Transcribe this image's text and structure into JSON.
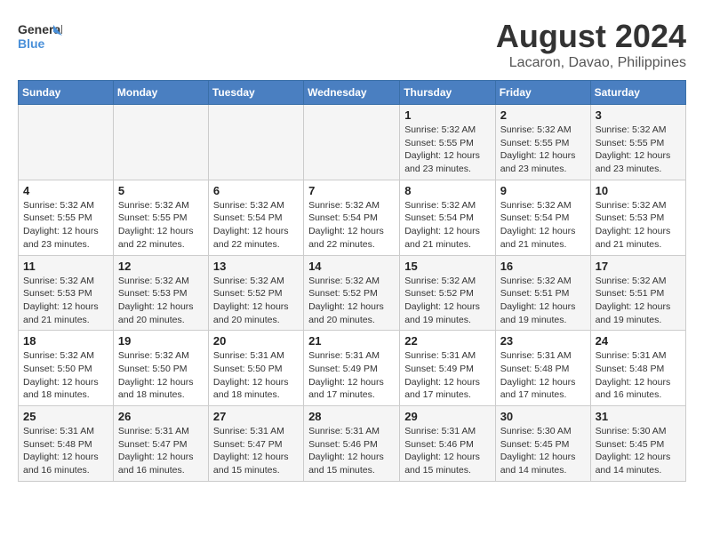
{
  "header": {
    "logo_line1": "General",
    "logo_line2": "Blue",
    "month_year": "August 2024",
    "location": "Lacaron, Davao, Philippines"
  },
  "days_of_week": [
    "Sunday",
    "Monday",
    "Tuesday",
    "Wednesday",
    "Thursday",
    "Friday",
    "Saturday"
  ],
  "weeks": [
    [
      {
        "day": "",
        "info": ""
      },
      {
        "day": "",
        "info": ""
      },
      {
        "day": "",
        "info": ""
      },
      {
        "day": "",
        "info": ""
      },
      {
        "day": "1",
        "info": "Sunrise: 5:32 AM\nSunset: 5:55 PM\nDaylight: 12 hours\nand 23 minutes."
      },
      {
        "day": "2",
        "info": "Sunrise: 5:32 AM\nSunset: 5:55 PM\nDaylight: 12 hours\nand 23 minutes."
      },
      {
        "day": "3",
        "info": "Sunrise: 5:32 AM\nSunset: 5:55 PM\nDaylight: 12 hours\nand 23 minutes."
      }
    ],
    [
      {
        "day": "4",
        "info": "Sunrise: 5:32 AM\nSunset: 5:55 PM\nDaylight: 12 hours\nand 23 minutes."
      },
      {
        "day": "5",
        "info": "Sunrise: 5:32 AM\nSunset: 5:55 PM\nDaylight: 12 hours\nand 22 minutes."
      },
      {
        "day": "6",
        "info": "Sunrise: 5:32 AM\nSunset: 5:54 PM\nDaylight: 12 hours\nand 22 minutes."
      },
      {
        "day": "7",
        "info": "Sunrise: 5:32 AM\nSunset: 5:54 PM\nDaylight: 12 hours\nand 22 minutes."
      },
      {
        "day": "8",
        "info": "Sunrise: 5:32 AM\nSunset: 5:54 PM\nDaylight: 12 hours\nand 21 minutes."
      },
      {
        "day": "9",
        "info": "Sunrise: 5:32 AM\nSunset: 5:54 PM\nDaylight: 12 hours\nand 21 minutes."
      },
      {
        "day": "10",
        "info": "Sunrise: 5:32 AM\nSunset: 5:53 PM\nDaylight: 12 hours\nand 21 minutes."
      }
    ],
    [
      {
        "day": "11",
        "info": "Sunrise: 5:32 AM\nSunset: 5:53 PM\nDaylight: 12 hours\nand 21 minutes."
      },
      {
        "day": "12",
        "info": "Sunrise: 5:32 AM\nSunset: 5:53 PM\nDaylight: 12 hours\nand 20 minutes."
      },
      {
        "day": "13",
        "info": "Sunrise: 5:32 AM\nSunset: 5:52 PM\nDaylight: 12 hours\nand 20 minutes."
      },
      {
        "day": "14",
        "info": "Sunrise: 5:32 AM\nSunset: 5:52 PM\nDaylight: 12 hours\nand 20 minutes."
      },
      {
        "day": "15",
        "info": "Sunrise: 5:32 AM\nSunset: 5:52 PM\nDaylight: 12 hours\nand 19 minutes."
      },
      {
        "day": "16",
        "info": "Sunrise: 5:32 AM\nSunset: 5:51 PM\nDaylight: 12 hours\nand 19 minutes."
      },
      {
        "day": "17",
        "info": "Sunrise: 5:32 AM\nSunset: 5:51 PM\nDaylight: 12 hours\nand 19 minutes."
      }
    ],
    [
      {
        "day": "18",
        "info": "Sunrise: 5:32 AM\nSunset: 5:50 PM\nDaylight: 12 hours\nand 18 minutes."
      },
      {
        "day": "19",
        "info": "Sunrise: 5:32 AM\nSunset: 5:50 PM\nDaylight: 12 hours\nand 18 minutes."
      },
      {
        "day": "20",
        "info": "Sunrise: 5:31 AM\nSunset: 5:50 PM\nDaylight: 12 hours\nand 18 minutes."
      },
      {
        "day": "21",
        "info": "Sunrise: 5:31 AM\nSunset: 5:49 PM\nDaylight: 12 hours\nand 17 minutes."
      },
      {
        "day": "22",
        "info": "Sunrise: 5:31 AM\nSunset: 5:49 PM\nDaylight: 12 hours\nand 17 minutes."
      },
      {
        "day": "23",
        "info": "Sunrise: 5:31 AM\nSunset: 5:48 PM\nDaylight: 12 hours\nand 17 minutes."
      },
      {
        "day": "24",
        "info": "Sunrise: 5:31 AM\nSunset: 5:48 PM\nDaylight: 12 hours\nand 16 minutes."
      }
    ],
    [
      {
        "day": "25",
        "info": "Sunrise: 5:31 AM\nSunset: 5:48 PM\nDaylight: 12 hours\nand 16 minutes."
      },
      {
        "day": "26",
        "info": "Sunrise: 5:31 AM\nSunset: 5:47 PM\nDaylight: 12 hours\nand 16 minutes."
      },
      {
        "day": "27",
        "info": "Sunrise: 5:31 AM\nSunset: 5:47 PM\nDaylight: 12 hours\nand 15 minutes."
      },
      {
        "day": "28",
        "info": "Sunrise: 5:31 AM\nSunset: 5:46 PM\nDaylight: 12 hours\nand 15 minutes."
      },
      {
        "day": "29",
        "info": "Sunrise: 5:31 AM\nSunset: 5:46 PM\nDaylight: 12 hours\nand 15 minutes."
      },
      {
        "day": "30",
        "info": "Sunrise: 5:30 AM\nSunset: 5:45 PM\nDaylight: 12 hours\nand 14 minutes."
      },
      {
        "day": "31",
        "info": "Sunrise: 5:30 AM\nSunset: 5:45 PM\nDaylight: 12 hours\nand 14 minutes."
      }
    ]
  ]
}
